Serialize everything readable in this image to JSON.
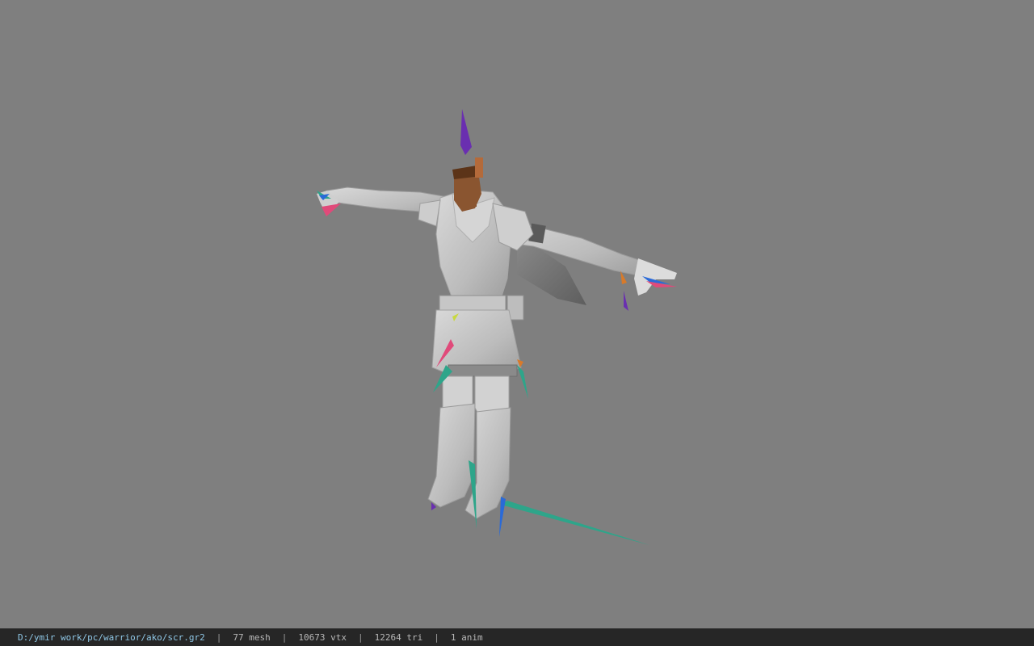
{
  "viewport": {
    "background": "#7f7f7f",
    "model_description_icon": "character-model"
  },
  "statusbar": {
    "file_path": "D:/ymir work/pc/warrior/ako/scr.gr2",
    "separator": "|",
    "mesh_count": "77 mesh",
    "vertex_count": "10673 vtx",
    "triangle_count": "12264 tri",
    "anim_count": "1 anim"
  },
  "colors": {
    "path_text": "#8fc7e6",
    "status_bg": "#262626",
    "bone_purple": "#6a2fb0",
    "bone_teal": "#2ea58a",
    "bone_pink": "#e04a7a",
    "bone_orange": "#d87a2a",
    "bone_blue": "#2a6ad8"
  }
}
